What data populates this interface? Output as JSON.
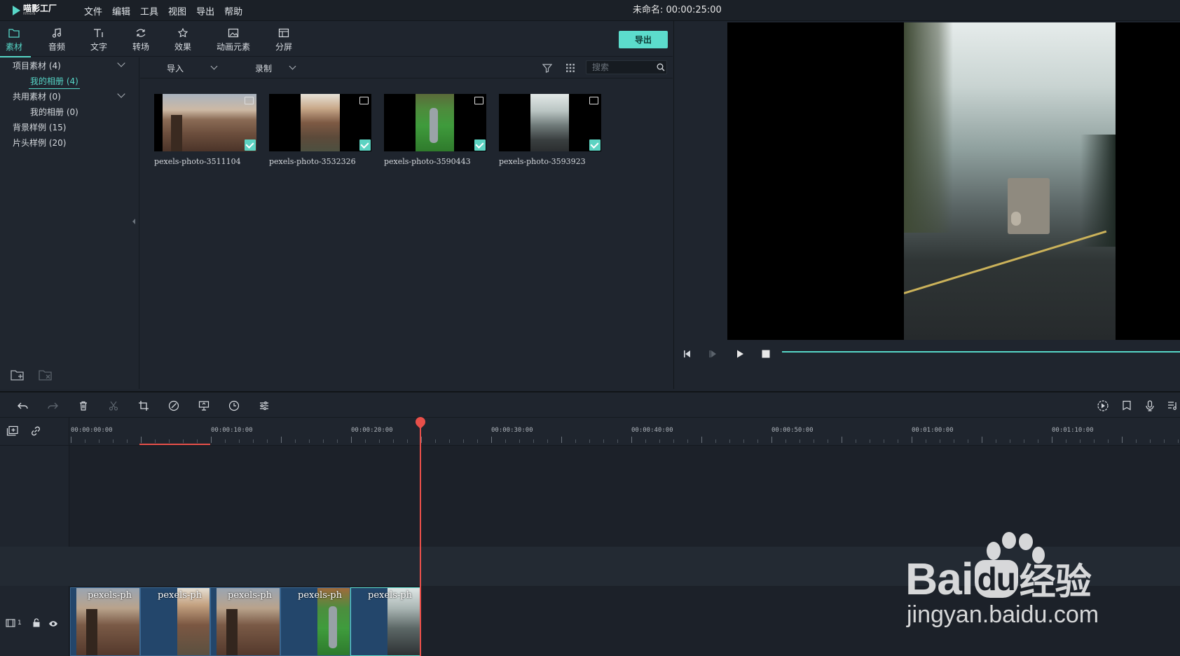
{
  "app": {
    "logo_text": "喵影工厂",
    "logo_sub": "filmora",
    "menus": [
      "文件",
      "编辑",
      "工具",
      "视图",
      "导出",
      "帮助"
    ],
    "project_title": "未命名: 00:00:25:00"
  },
  "tabs": [
    {
      "label": "素材",
      "icon": "folder-icon",
      "active": true
    },
    {
      "label": "音频",
      "icon": "music-note-icon"
    },
    {
      "label": "文字",
      "icon": "text-icon"
    },
    {
      "label": "转场",
      "icon": "transition-icon"
    },
    {
      "label": "效果",
      "icon": "effects-icon"
    },
    {
      "label": "动画元素",
      "icon": "image-icon"
    },
    {
      "label": "分屏",
      "icon": "split-screen-icon"
    }
  ],
  "export_label": "导出",
  "tree": [
    {
      "label": "项目素材 (4)",
      "expandable": true
    },
    {
      "label": "我的相册 (4)",
      "selected": true
    },
    {
      "label": "共用素材 (0)",
      "expandable": true
    },
    {
      "label": "我的相册 (0)"
    },
    {
      "label": "背景样例 (15)"
    },
    {
      "label": "片头样例 (20)"
    }
  ],
  "media_toolbar": {
    "import_label": "导入",
    "record_label": "录制",
    "search_placeholder": "搜索"
  },
  "media": [
    {
      "name": "pexels-photo-3511104",
      "checked": true
    },
    {
      "name": "pexels-photo-3532326",
      "checked": true
    },
    {
      "name": "pexels-photo-3590443",
      "checked": true
    },
    {
      "name": "pexels-photo-3593923",
      "checked": true
    }
  ],
  "timeline": {
    "ticks": [
      "00:00:00:00",
      "00:00:10:00",
      "00:00:20:00",
      "00:00:30:00",
      "00:00:40:00",
      "00:00:50:00",
      "00:01:00:00",
      "00:01:10:00"
    ],
    "track_number": "1",
    "clips": [
      {
        "label": "pexels-ph"
      },
      {
        "label": "pexels-ph"
      },
      {
        "label": "pexels-ph"
      },
      {
        "label": "pexels-ph"
      },
      {
        "label": "pexels-ph"
      }
    ]
  },
  "watermark": {
    "text": "Bai",
    "text_du": "du",
    "text_cn": "经验",
    "url": "jingyan.baidu.com"
  },
  "colors": {
    "accent": "#56d6c7",
    "playhead": "#e8504a",
    "clip": "#23466b"
  }
}
